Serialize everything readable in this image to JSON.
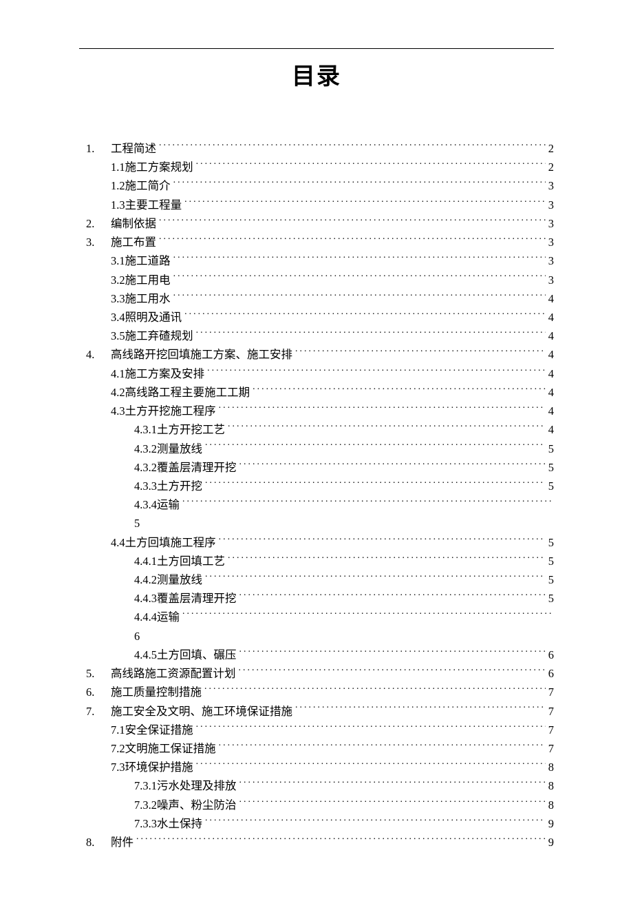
{
  "title": "目录",
  "toc": [
    {
      "level": 0,
      "num": "1.",
      "text": "工程简述",
      "page": "2"
    },
    {
      "level": 1,
      "num": "1.1",
      "text": "施工方案规划",
      "page": "2",
      "spaced": true
    },
    {
      "level": 1,
      "num": "1.2",
      "text": "施工简介",
      "page": "3",
      "spaced": true
    },
    {
      "level": 1,
      "num": "1.3",
      "text": "主要工程量",
      "page": "3"
    },
    {
      "level": 0,
      "num": "2.",
      "text": "编制依据",
      "page": "3"
    },
    {
      "level": 0,
      "num": "3.",
      "text": "施工布置",
      "page": "3"
    },
    {
      "level": 1,
      "num": "3.1",
      "text": "施工道路",
      "page": "3",
      "spaced": true
    },
    {
      "level": 1,
      "num": "3.2",
      "text": "施工用电",
      "page": "3",
      "spaced": true
    },
    {
      "level": 1,
      "num": "3.3",
      "text": "施工用水",
      "page": "4",
      "spaced": true
    },
    {
      "level": 1,
      "num": "3.4",
      "text": "照明及通讯",
      "page": "4"
    },
    {
      "level": 1,
      "num": "3.5",
      "text": "施工弃碴规划",
      "page": "4"
    },
    {
      "level": 0,
      "num": "4.",
      "text": "高线路开挖回填施工方案、施工安排",
      "page": "4"
    },
    {
      "level": 1,
      "num": "4.1",
      "text": "施工方案及安排",
      "page": "4"
    },
    {
      "level": 1,
      "num": "4.2",
      "text": "高线路工程主要施工工期",
      "page": "4"
    },
    {
      "level": 1,
      "num": "4.3",
      "text": "土方开挖施工程序",
      "page": "4",
      "spaced": true
    },
    {
      "level": 2,
      "num": "4.3.1",
      "text": "土方开挖工艺",
      "page": "4",
      "spaced": true
    },
    {
      "level": 2,
      "num": "4.3.2",
      "text": "测量放线",
      "page": "5"
    },
    {
      "level": 2,
      "num": "4.3.2",
      "text": "覆盖层清理开挖",
      "page": "5"
    },
    {
      "level": 2,
      "num": "4.3.3",
      "text": "土方开挖",
      "page": "5",
      "spaced": true
    },
    {
      "level": 2,
      "num": "4.3.4",
      "text": "运输",
      "page": "5",
      "wrap": true
    },
    {
      "level": 1,
      "num": "4.4",
      "text": "土方回填施工程序",
      "page": "5",
      "spaced": true
    },
    {
      "level": 2,
      "num": "4.4.1",
      "text": "土方回填工艺",
      "page": "5",
      "spaced": true
    },
    {
      "level": 2,
      "num": "4.4.2",
      "text": "测量放线",
      "page": "5"
    },
    {
      "level": 2,
      "num": "4.4.3",
      "text": "覆盖层清理开挖",
      "page": "5"
    },
    {
      "level": 2,
      "num": "4.4.4",
      "text": "运输",
      "page": "6",
      "wrap": true
    },
    {
      "level": 2,
      "num": "4.4.5",
      "text": "土方回填、碾压",
      "page": "6",
      "spaced": true
    },
    {
      "level": 0,
      "num": "5.",
      "text": "高线路施工资源配置计划",
      "page": "6"
    },
    {
      "level": 0,
      "num": "6.",
      "text": "施工质量控制措施",
      "page": "7"
    },
    {
      "level": 0,
      "num": "7.",
      "text": "施工安全及文明、施工环境保证措施",
      "page": "7"
    },
    {
      "level": 1,
      "num": "7.1",
      "text": "安全保证措施",
      "page": "7"
    },
    {
      "level": 1,
      "num": "7.2",
      "text": "文明施工保证措施",
      "page": "7",
      "spaced": true
    },
    {
      "level": 1,
      "num": "7.3",
      "text": "环境保护措施",
      "page": "8"
    },
    {
      "level": 2,
      "num": "7.3.1",
      "text": "污水处理及排放",
      "page": "8"
    },
    {
      "level": 2,
      "num": "7.3.2",
      "text": "噪声、粉尘防治",
      "page": "8"
    },
    {
      "level": 2,
      "num": "7.3.3",
      "text": "水土保持",
      "page": "9",
      "spaced": true
    },
    {
      "level": 0,
      "num": "8.",
      "text": "附件",
      "page": "9"
    }
  ]
}
